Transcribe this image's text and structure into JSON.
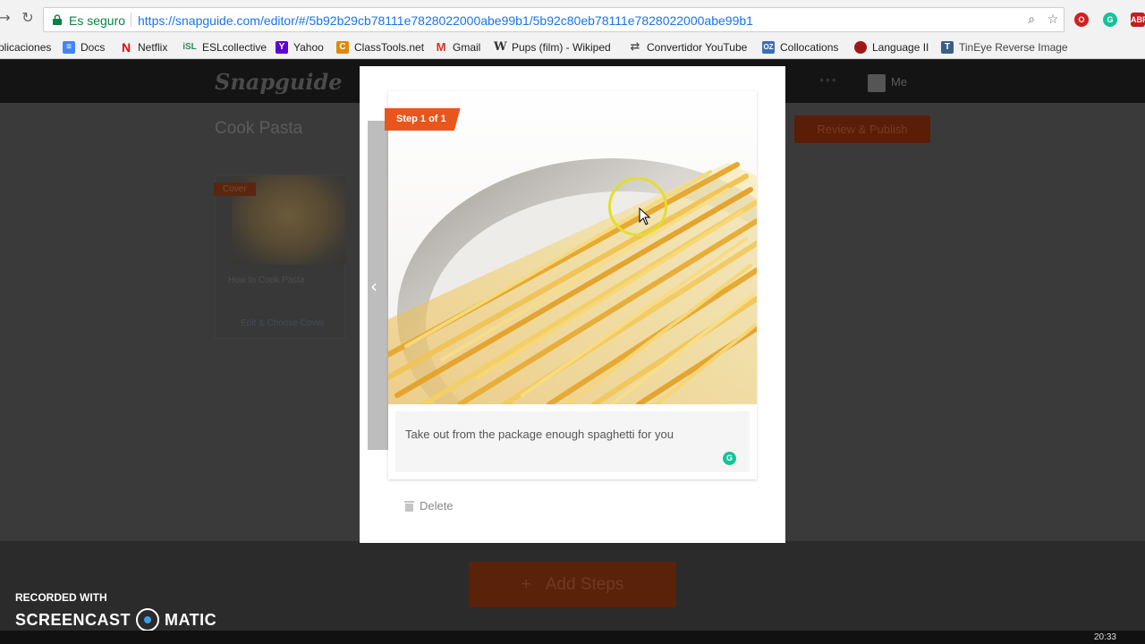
{
  "browser": {
    "secure_label": "Es seguro",
    "url": "https://snapguide.com/editor/#/5b92b29cb78111e7828022000abe99b1/5b92c80eb78111e7828022000abe99b1"
  },
  "bookmarks": [
    {
      "label": "plicaciones",
      "icon": "apps-grid-icon",
      "color": "#4285f4"
    },
    {
      "label": "Docs",
      "icon": "docs-icon",
      "color": "#4285f4"
    },
    {
      "label": "Netflix",
      "icon": "netflix-icon",
      "color": "#e50914"
    },
    {
      "label": "ESLcollective",
      "icon": "isl-icon",
      "color": "#2e8b57"
    },
    {
      "label": "Yahoo",
      "icon": "yahoo-icon",
      "color": "#5f01d1"
    },
    {
      "label": "ClassTools.net",
      "icon": "classtools-icon",
      "color": "#e08a00"
    },
    {
      "label": "Gmail",
      "icon": "gmail-icon",
      "color": "#d93025"
    },
    {
      "label": "Pups (film) - Wikiped",
      "icon": "wikipedia-icon",
      "color": "#333333"
    },
    {
      "label": "Convertidor YouTube",
      "icon": "convert-icon",
      "color": "#555555"
    },
    {
      "label": "Collocations",
      "icon": "oz-icon",
      "color": "#3b6fb6"
    },
    {
      "label": "Language II",
      "icon": "language-icon",
      "color": "#a01818"
    },
    {
      "label": "TinEye Reverse Image",
      "icon": "tineye-icon",
      "color": "#3a5f8a"
    }
  ],
  "site": {
    "logo": "Snapguide",
    "me_label": "Me",
    "guide_title": "Cook Pasta",
    "publish_label": "Review & Publish",
    "cover_tag": "Cover",
    "cover_name": "How to Cook Pasta",
    "cover_edit": "Edit & Choose Cover",
    "add_steps_label": "Add Steps"
  },
  "modal": {
    "step_badge": "Step 1 of 1",
    "caption": "Take out from the package enough spaghetti for you",
    "delete_label": "Delete"
  },
  "overlay": {
    "watermark_line1": "RECORDED WITH",
    "watermark_brand_a": "SCREENCAST",
    "watermark_brand_b": "MATIC",
    "clock": "20:33"
  },
  "colors": {
    "accent": "#e8561c",
    "grammarly": "#15c39a"
  }
}
